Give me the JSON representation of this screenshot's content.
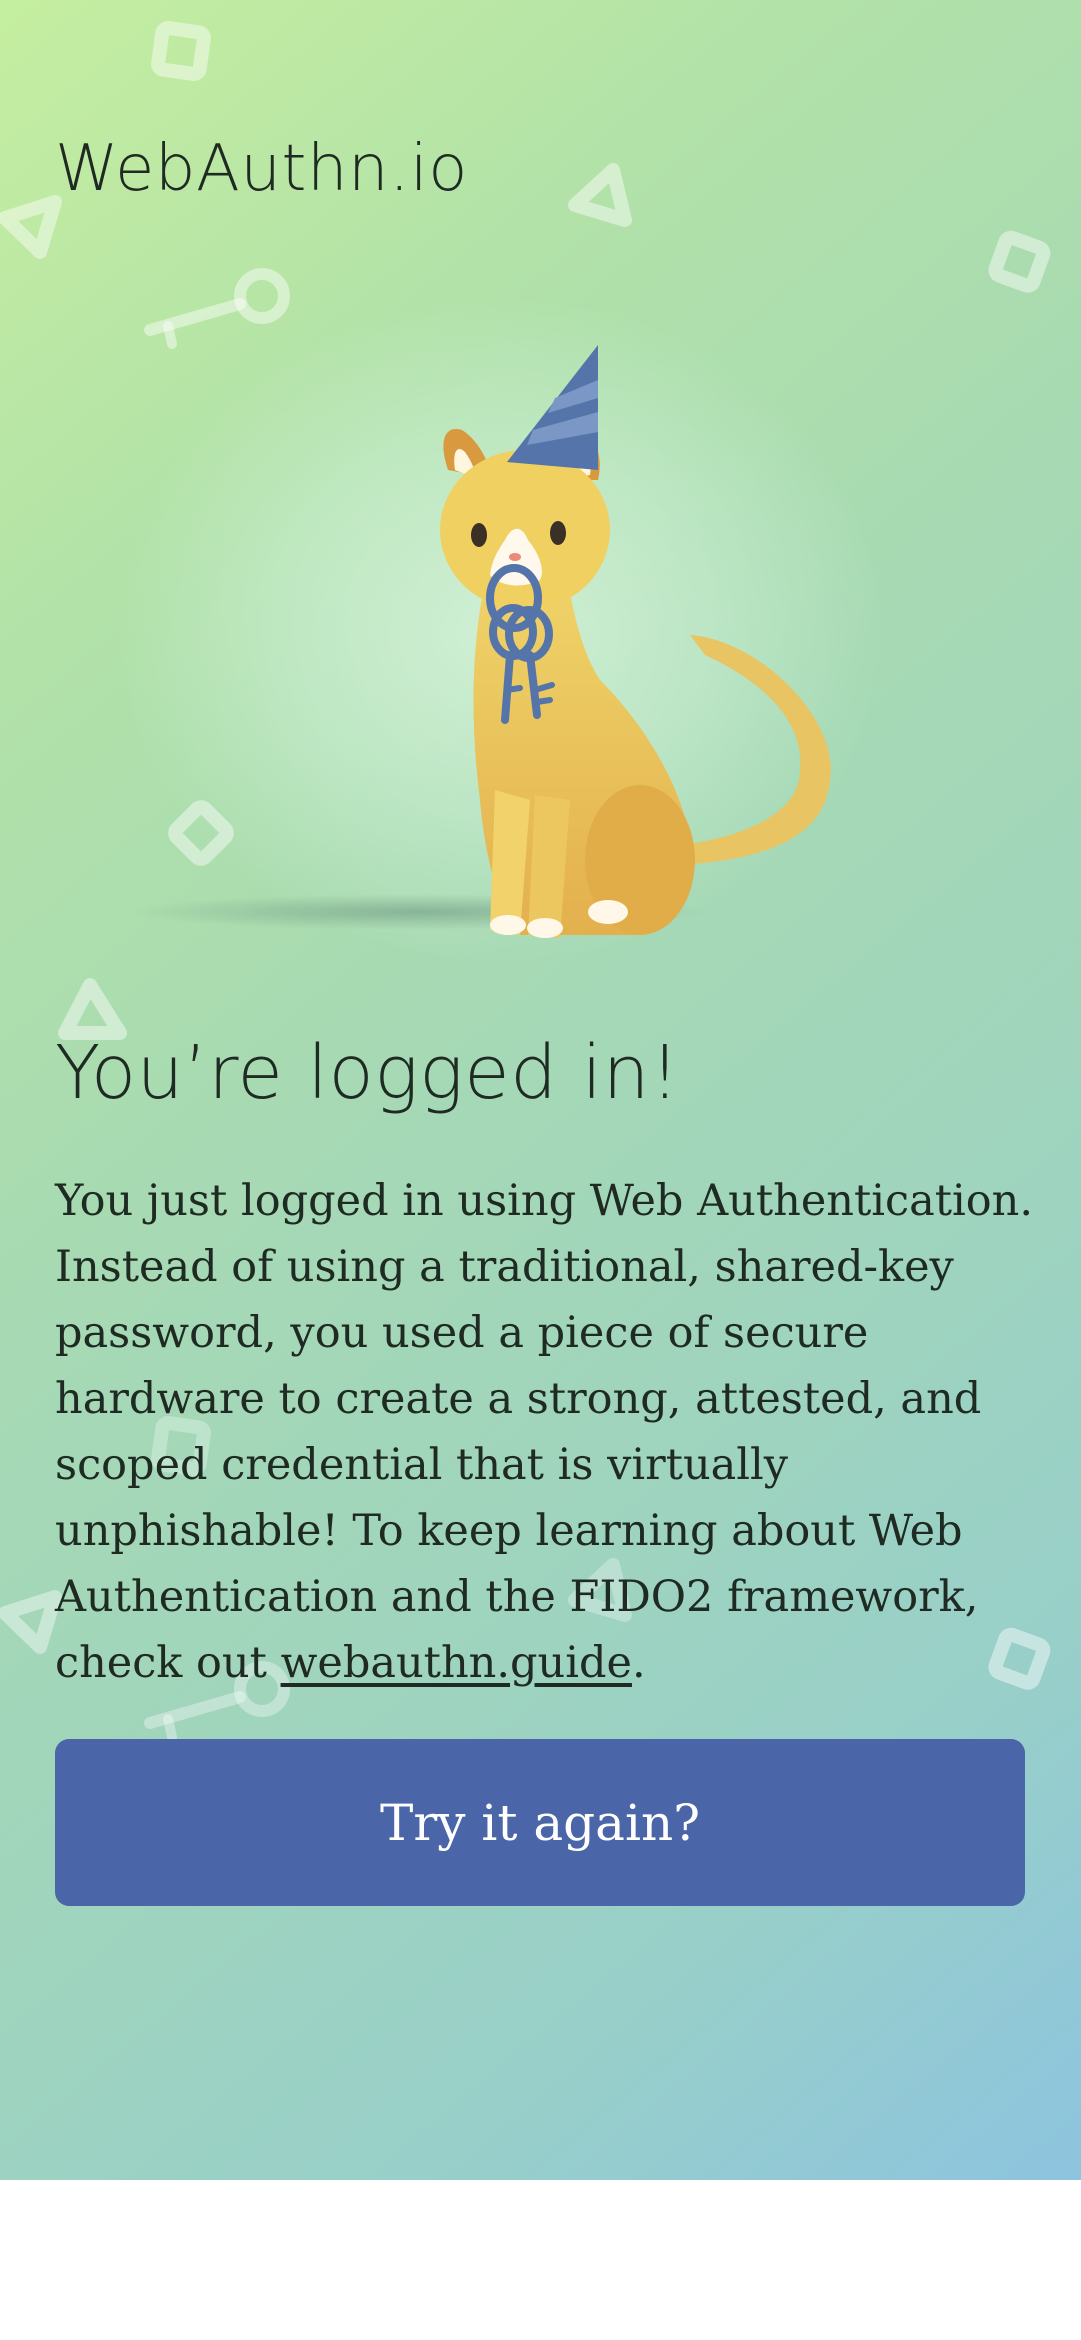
{
  "header": {
    "logo_text": "WebAuthn.io"
  },
  "illustration": {
    "name": "party-cat-with-keys"
  },
  "main": {
    "title": "You’re logged in!",
    "message_before_link": "You just logged in using Web Authentication. Instead of using a traditional, shared-key password, you used a piece of secure hardware to create a strong, attested, and scoped credential that is virtually unphishable! To keep learning about Web Authentication and the FIDO2 framework, check out ",
    "link_text": "webauthn.guide",
    "message_after_link": ".",
    "retry_button_label": "Try it again?"
  },
  "colors": {
    "button": "#4a65a8",
    "text": "#1f2a22",
    "background_start": "#c5eea0",
    "background_end": "#8dc4df"
  },
  "decorations": [
    "square-icon",
    "triangle-icon",
    "key-icon",
    "square-icon"
  ]
}
